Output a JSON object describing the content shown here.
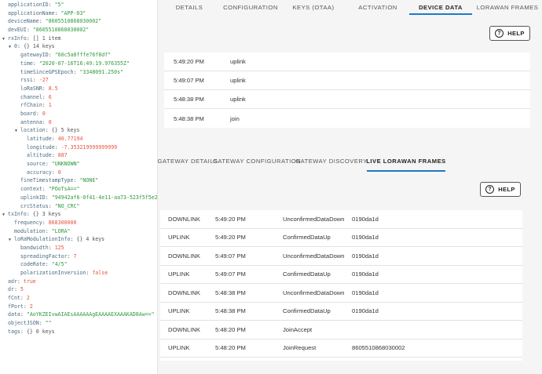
{
  "tree": [
    {
      "d": 0,
      "k": "applicationID",
      "v": "\"5\"",
      "t": "s"
    },
    {
      "d": 0,
      "k": "applicationName",
      "v": "\"APP-03\"",
      "t": "s"
    },
    {
      "d": 0,
      "k": "deviceName",
      "v": "\"8605510868030002\"",
      "t": "s"
    },
    {
      "d": 0,
      "k": "devEUI",
      "v": "\"8605510868030002\"",
      "t": "s"
    },
    {
      "d": 0,
      "k": "rxInfo",
      "v": "[] 1 item",
      "t": "m",
      "c": true
    },
    {
      "d": 1,
      "k": "0",
      "v": "{} 14 keys",
      "t": "m",
      "c": true
    },
    {
      "d": 2,
      "k": "gatewayID",
      "v": "\"60c5a8fffe76f8df\"",
      "t": "s"
    },
    {
      "d": 2,
      "k": "time",
      "v": "\"2020-07-16T16:49:19.976355Z\"",
      "t": "s"
    },
    {
      "d": 2,
      "k": "timeSinceGPSEpoch",
      "v": "\"3348091.250s\"",
      "t": "s"
    },
    {
      "d": 2,
      "k": "rssi",
      "v": "-27",
      "t": "n"
    },
    {
      "d": 2,
      "k": "loRaSNR",
      "v": "8.5",
      "t": "n"
    },
    {
      "d": 2,
      "k": "channel",
      "v": "6",
      "t": "n"
    },
    {
      "d": 2,
      "k": "rfChain",
      "v": "1",
      "t": "n"
    },
    {
      "d": 2,
      "k": "board",
      "v": "0",
      "t": "n"
    },
    {
      "d": 2,
      "k": "antenna",
      "v": "0",
      "t": "n"
    },
    {
      "d": 2,
      "k": "location",
      "v": "{} 5 keys",
      "t": "m",
      "c": true
    },
    {
      "d": 3,
      "k": "latitude",
      "v": "40.77194",
      "t": "n"
    },
    {
      "d": 3,
      "k": "longitude",
      "v": "-7.353219999999999",
      "t": "n"
    },
    {
      "d": 3,
      "k": "altitude",
      "v": "887",
      "t": "n"
    },
    {
      "d": 3,
      "k": "source",
      "v": "\"UNKNOWN\"",
      "t": "s"
    },
    {
      "d": 3,
      "k": "accuracy",
      "v": "0",
      "t": "n"
    },
    {
      "d": 2,
      "k": "fineTimestampType",
      "v": "\"NONE\"",
      "t": "s"
    },
    {
      "d": 2,
      "k": "context",
      "v": "\"POoTsA==\"",
      "t": "s"
    },
    {
      "d": 2,
      "k": "uplinkID",
      "v": "\"94942af6-0f41-4e11-aa73-523f5f5e2a19\"",
      "t": "s"
    },
    {
      "d": 2,
      "k": "crcStatus",
      "v": "\"NO_CRC\"",
      "t": "s"
    },
    {
      "d": 0,
      "k": "txInfo",
      "v": "{} 3 keys",
      "t": "m",
      "c": true
    },
    {
      "d": 1,
      "k": "frequency",
      "v": "868300000",
      "t": "n"
    },
    {
      "d": 1,
      "k": "modulation",
      "v": "\"LORA\"",
      "t": "s"
    },
    {
      "d": 1,
      "k": "loRaModulationInfo",
      "v": "{} 4 keys",
      "t": "m",
      "c": true
    },
    {
      "d": 2,
      "k": "bandwidth",
      "v": "125",
      "t": "n"
    },
    {
      "d": 2,
      "k": "spreadingFactor",
      "v": "7",
      "t": "n"
    },
    {
      "d": 2,
      "k": "codeRate",
      "v": "\"4/5\"",
      "t": "s"
    },
    {
      "d": 2,
      "k": "polarizationInversion",
      "v": "false",
      "t": "b"
    },
    {
      "d": 0,
      "k": "adr",
      "v": "true",
      "t": "b"
    },
    {
      "d": 0,
      "k": "dr",
      "v": "5",
      "t": "n"
    },
    {
      "d": 0,
      "k": "fCnt",
      "v": "2",
      "t": "n"
    },
    {
      "d": 0,
      "k": "fPort",
      "v": "2",
      "t": "n"
    },
    {
      "d": 0,
      "k": "data",
      "v": "\"AoYKZEIvwAIAEsAAAAAAgEAAAAEXAAAKAD8Aw==\"",
      "t": "s"
    },
    {
      "d": 0,
      "k": "objectJSON",
      "v": "\"\"",
      "t": "s"
    },
    {
      "d": 0,
      "k": "tags",
      "v": "{} 0 keys",
      "t": "m"
    }
  ],
  "device_tabs": [
    "DETAILS",
    "CONFIGURATION",
    "KEYS (OTAA)",
    "ACTIVATION",
    "DEVICE DATA",
    "LORAWAN FRAMES"
  ],
  "device_active_tab": 4,
  "help_label": "HELP",
  "help_icon_glyph": "?",
  "device_events": [
    {
      "time": "5:49:20 PM",
      "type": "uplink"
    },
    {
      "time": "5:49:07 PM",
      "type": "uplink"
    },
    {
      "time": "5:48:38 PM",
      "type": "uplink"
    },
    {
      "time": "5:48:38 PM",
      "type": "join"
    }
  ],
  "gateway_tabs": [
    "GATEWAY DETAILS",
    "GATEWAY CONFIGURATION",
    "GATEWAY DISCOVERY",
    "LIVE LORAWAN FRAMES"
  ],
  "gateway_active_tab": 3,
  "frames": [
    {
      "dir": "DOWNLINK",
      "time": "5:49:20 PM",
      "mtype": "UnconfirmedDataDown",
      "dev": "0190da1d"
    },
    {
      "dir": "UPLINK",
      "time": "5:49:20 PM",
      "mtype": "ConfirmedDataUp",
      "dev": "0190da1d"
    },
    {
      "dir": "DOWNLINK",
      "time": "5:49:07 PM",
      "mtype": "UnconfirmedDataDown",
      "dev": "0190da1d"
    },
    {
      "dir": "UPLINK",
      "time": "5:49:07 PM",
      "mtype": "ConfirmedDataUp",
      "dev": "0190da1d"
    },
    {
      "dir": "DOWNLINK",
      "time": "5:48:38 PM",
      "mtype": "UnconfirmedDataDown",
      "dev": "0190da1d"
    },
    {
      "dir": "UPLINK",
      "time": "5:48:38 PM",
      "mtype": "ConfirmedDataUp",
      "dev": "0190da1d"
    },
    {
      "dir": "DOWNLINK",
      "time": "5:48:20 PM",
      "mtype": "JoinAccept",
      "dev": ""
    },
    {
      "dir": "UPLINK",
      "time": "5:48:20 PM",
      "mtype": "JoinRequest",
      "dev": "8605510868030002"
    }
  ],
  "colors": {
    "accent": "#1f78c8",
    "string": "#2e9a3c",
    "number": "#e5533d",
    "key": "#4a6b82"
  }
}
